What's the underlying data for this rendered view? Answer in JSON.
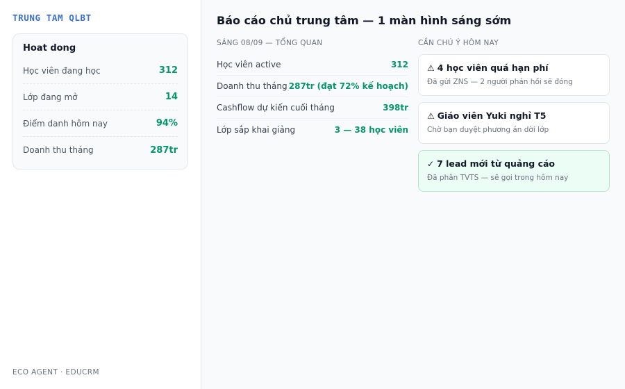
{
  "sidebar": {
    "brand": "TRUNG TAM QLBT",
    "card": {
      "title": "Hoat dong",
      "metrics": [
        {
          "label": "Học viên đang học",
          "value": "312"
        },
        {
          "label": "Lớp đang mở",
          "value": "14"
        },
        {
          "label": "Điểm danh hôm nay",
          "value": "94%"
        },
        {
          "label": "Doanh thu tháng",
          "value": "287tr"
        }
      ]
    },
    "footer": "ECO AGENT · EDUCRM"
  },
  "main": {
    "title": "Báo cáo chủ trung tâm — 1 màn hình sáng sớm",
    "overview": {
      "label": "SÁNG 08/09 — TỔNG QUAN",
      "rows": [
        {
          "label": "Học viên active",
          "value": "312"
        },
        {
          "label": "Doanh thu tháng",
          "value": "287tr (đạt 72% kế hoạch)"
        },
        {
          "label": "Cashflow dự kiến cuối tháng",
          "value": "398tr"
        },
        {
          "label": "Lớp sắp khai giảng",
          "value": "3 — 38 học viên"
        }
      ]
    },
    "attention": {
      "label": "CẦN CHÚ Ý HÔM NAY",
      "items": [
        {
          "icon": "⚠",
          "icon_name": "warning-icon",
          "title": "4 học viên quá hạn phí",
          "sub": "Đã gửi ZNS — 2 người phản hồi sẽ đóng"
        },
        {
          "icon": "⚠",
          "icon_name": "warning-icon",
          "title": "Giáo viên Yuki nghỉ T5",
          "sub": "Chờ bạn duyệt phương án dời lớp"
        },
        {
          "icon": "✓",
          "icon_name": "check-icon",
          "title": "7 lead mới từ quảng cáo",
          "sub": "Đã phân TVTS — sẽ gọi trong hôm nay"
        }
      ]
    }
  },
  "colors": {
    "brand": "#3b6fd1",
    "positive": "#059669",
    "success_bg": "#ecfdf5"
  }
}
